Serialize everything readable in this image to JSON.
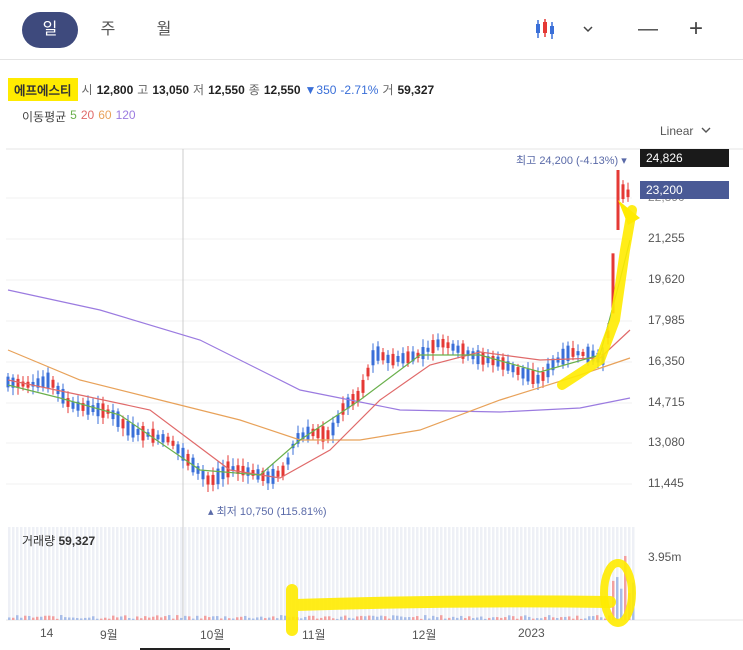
{
  "tabs": [
    {
      "label": "일",
      "active": true
    },
    {
      "label": "주",
      "active": false
    },
    {
      "label": "월",
      "active": false
    }
  ],
  "toolbar": {
    "chart_type_icon": "candlestick-icon",
    "dropdown_icon": "chevron-down-icon",
    "minus": "—",
    "plus": "+"
  },
  "stock": {
    "name": "에프에스티",
    "open_label": "시",
    "open": "12,800",
    "high_label": "고",
    "high": "13,050",
    "low_label": "저",
    "low": "12,550",
    "close_label": "종",
    "close": "12,550",
    "change": "▼350",
    "change_pct": "-2.71%",
    "volume_label": "거",
    "volume": "59,327"
  },
  "ma": {
    "label": "이동평균",
    "periods": [
      "5",
      "20",
      "60",
      "120"
    ],
    "colors": [
      "#6ab04c",
      "#e06a6a",
      "#e8a25a",
      "#9b7be0"
    ]
  },
  "scale": {
    "label": "Linear"
  },
  "price_levels": [
    "22,890",
    "21,255",
    "19,620",
    "17,985",
    "16,350",
    "14,715",
    "13,080",
    "11,445"
  ],
  "badges": {
    "top": "24,826",
    "current": "23,200"
  },
  "annotations": {
    "high_label": "최고",
    "high_value": "24,200 (-4.13%)",
    "low_label": "최저",
    "low_value": "10,750 (115.81%)"
  },
  "volume_panel": {
    "label": "거래량",
    "value": "59,327",
    "scale_max": "3.95m"
  },
  "x_labels": [
    "14",
    "9월",
    "10월",
    "11월",
    "12월",
    "2023"
  ],
  "colors": {
    "up": "#e53935",
    "down": "#3a6fd8",
    "highlight": "#ffeb00",
    "badge_dark": "#1a1a1a",
    "badge_blue": "#4a5a96"
  }
}
